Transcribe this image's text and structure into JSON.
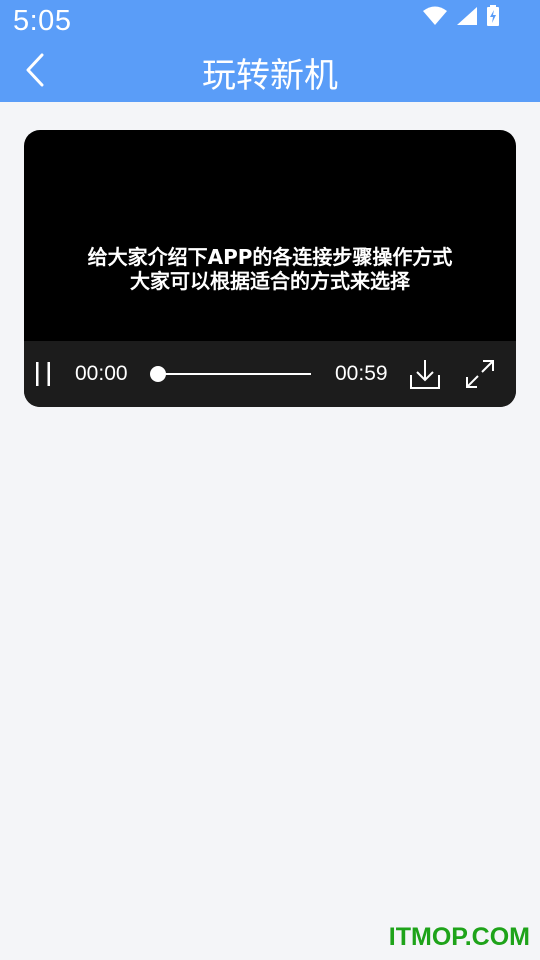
{
  "status_bar": {
    "time": "5:05",
    "icons": [
      "wifi-icon",
      "signal-icon",
      "battery-charging-icon"
    ]
  },
  "header": {
    "title": "玩转新机",
    "back_icon": "chevron-left-icon",
    "background_color": "#5a9df8"
  },
  "video": {
    "subtitle_line1": "给大家介绍下APP的各连接步骤操作方式",
    "subtitle_line2": "大家可以根据适合的方式来选择",
    "current_time": "00:00",
    "total_time": "00:59",
    "progress": 0,
    "icons": [
      "pause-icon",
      "download-icon",
      "fullscreen-icon"
    ]
  },
  "watermark": {
    "text": "ITMOP.COM",
    "color": "#1ea31a"
  }
}
